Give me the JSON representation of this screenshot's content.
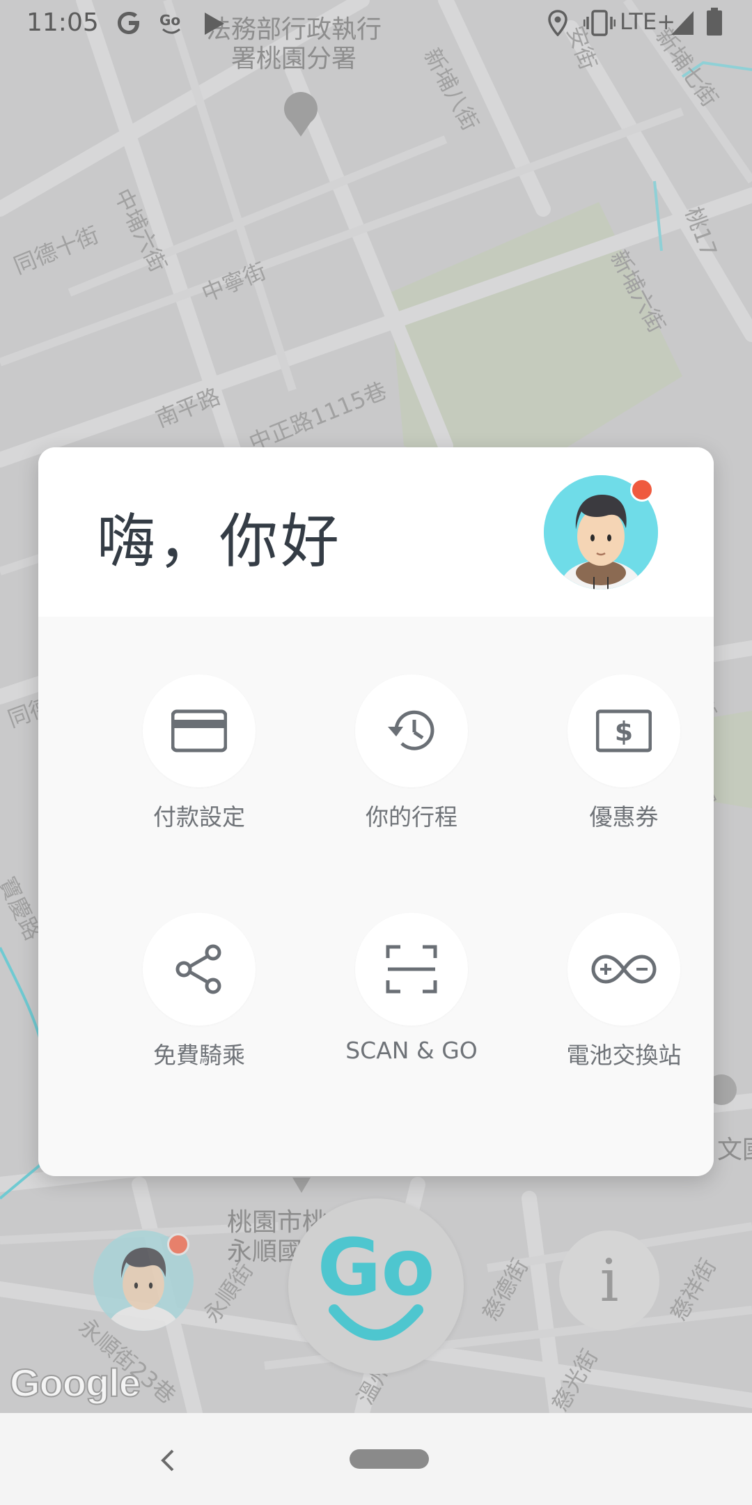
{
  "status_bar": {
    "time": "11:05",
    "network": "LTE+",
    "icons": [
      "google-icon",
      "go-app-icon",
      "play-store-icon",
      "location-icon",
      "vibrate-icon",
      "signal-icon",
      "battery-icon"
    ]
  },
  "map": {
    "labels": [
      {
        "id": "poi-office",
        "text": "法務部行政執行\n署桃園分署"
      },
      {
        "id": "st-xinbu8",
        "text": "新埔八街"
      },
      {
        "id": "st-anjie",
        "text": "安街"
      },
      {
        "id": "st-xinbu7",
        "text": "新埔七街"
      },
      {
        "id": "st-taoyuan17",
        "text": "桃17"
      },
      {
        "id": "st-zhongbu6",
        "text": "中埔六街"
      },
      {
        "id": "st-tongde10",
        "text": "同德十街"
      },
      {
        "id": "st-zhongning",
        "text": "中寧街"
      },
      {
        "id": "st-xinbu6",
        "text": "新埔六街"
      },
      {
        "id": "st-nanping",
        "text": "南平路"
      },
      {
        "id": "st-zhongzheng1115",
        "text": "中正路1115巷"
      },
      {
        "id": "st-tongde",
        "text": "同德"
      },
      {
        "id": "st-jie",
        "text": "街"
      },
      {
        "id": "st-duan",
        "text": "段"
      },
      {
        "id": "st-baoqing",
        "text": "寶慶路"
      },
      {
        "id": "poi-school",
        "text": "桃園市桃\n永順國"
      },
      {
        "id": "st-yongshun",
        "text": "永順街"
      },
      {
        "id": "st-yongshun23",
        "text": "永順街23巷"
      },
      {
        "id": "st-wen",
        "text": "溫州"
      },
      {
        "id": "st-cide",
        "text": "慈德街"
      },
      {
        "id": "st-cixiang",
        "text": "慈祥街"
      },
      {
        "id": "st-ciguang",
        "text": "慈光街"
      },
      {
        "id": "poi-wen",
        "text": "文國"
      }
    ],
    "attribution": "Google"
  },
  "card": {
    "greeting": "嗨，你好",
    "items": [
      {
        "label": "付款設定",
        "icon": "credit-card-icon"
      },
      {
        "label": "你的行程",
        "icon": "history-icon"
      },
      {
        "label": "優惠券",
        "icon": "coupon-icon"
      },
      {
        "label": "免費騎乘",
        "icon": "share-icon"
      },
      {
        "label": "SCAN & GO",
        "icon": "scan-icon"
      },
      {
        "label": "電池交換站",
        "icon": "battery-swap-icon"
      }
    ]
  },
  "bottom": {
    "go_label": "Go",
    "info_label": "i"
  },
  "colors": {
    "accent_teal": "#4ec6cf",
    "notification_red": "#ef5a3e",
    "title_text": "#343c45",
    "label_text": "#6f7378"
  }
}
